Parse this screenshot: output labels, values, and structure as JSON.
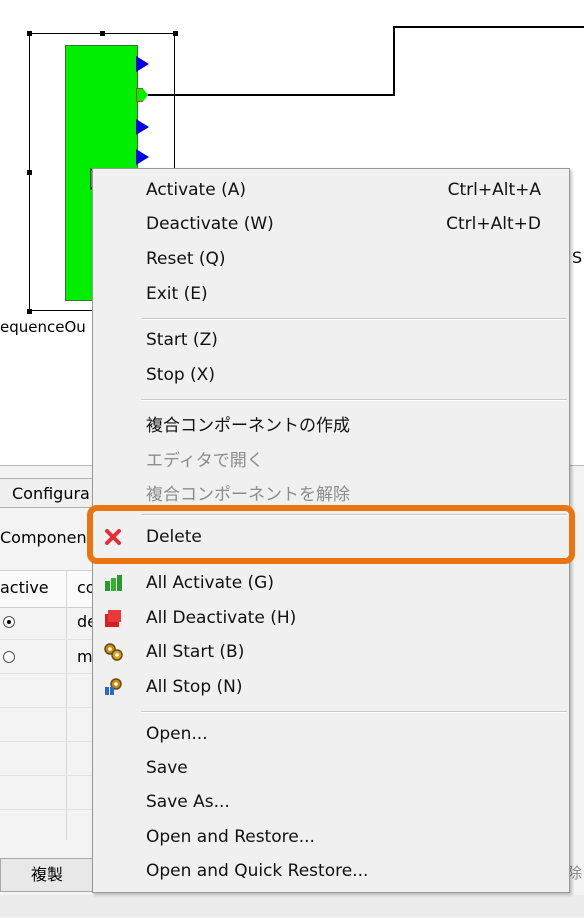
{
  "diagram": {
    "component_label": "equenceOu",
    "edge_label": "S"
  },
  "panel": {
    "tab_label": "Configura",
    "component_label": "Componen",
    "columns": [
      "active",
      "co"
    ],
    "rows": [
      {
        "active": true,
        "value": "de"
      },
      {
        "active": false,
        "value": "m"
      }
    ],
    "duplicate_button": "複製",
    "right_fragment": "除"
  },
  "context_menu": {
    "items": [
      {
        "label": "Activate (A)",
        "shortcut": "Ctrl+Alt+A",
        "enabled": true
      },
      {
        "label": "Deactivate (W)",
        "shortcut": "Ctrl+Alt+D",
        "enabled": true
      },
      {
        "label": "Reset (Q)",
        "shortcut": "",
        "enabled": true
      },
      {
        "label": "Exit (E)",
        "shortcut": "",
        "enabled": true
      },
      {
        "label": "Start (Z)",
        "shortcut": "",
        "enabled": true
      },
      {
        "label": "Stop (X)",
        "shortcut": "",
        "enabled": true
      },
      {
        "label": "複合コンポーネントの作成",
        "shortcut": "",
        "enabled": true
      },
      {
        "label": "エディタで開く",
        "shortcut": "",
        "enabled": false
      },
      {
        "label": "複合コンポーネントを解除",
        "shortcut": "",
        "enabled": false
      },
      {
        "label": "Delete",
        "shortcut": "",
        "enabled": true,
        "icon": "red-x-icon"
      },
      {
        "label": "All Activate (G)",
        "shortcut": "",
        "enabled": true,
        "icon": "all-activate-icon"
      },
      {
        "label": "All Deactivate (H)",
        "shortcut": "",
        "enabled": true,
        "icon": "all-deactivate-icon"
      },
      {
        "label": "All Start (B)",
        "shortcut": "",
        "enabled": true,
        "icon": "gears-start-icon"
      },
      {
        "label": "All Stop (N)",
        "shortcut": "",
        "enabled": true,
        "icon": "gears-stop-icon"
      },
      {
        "label": "Open...",
        "shortcut": "",
        "enabled": true
      },
      {
        "label": "Save",
        "shortcut": "",
        "enabled": true
      },
      {
        "label": "Save As...",
        "shortcut": "",
        "enabled": true
      },
      {
        "label": "Open and Restore...",
        "shortcut": "",
        "enabled": true
      },
      {
        "label": "Open and Quick Restore...",
        "shortcut": "",
        "enabled": true
      }
    ]
  },
  "colors": {
    "component_fill": "#00ee00",
    "port_fill": "#0000dd",
    "highlight_border": "#e87511",
    "delete_icon": "#e0303a"
  }
}
